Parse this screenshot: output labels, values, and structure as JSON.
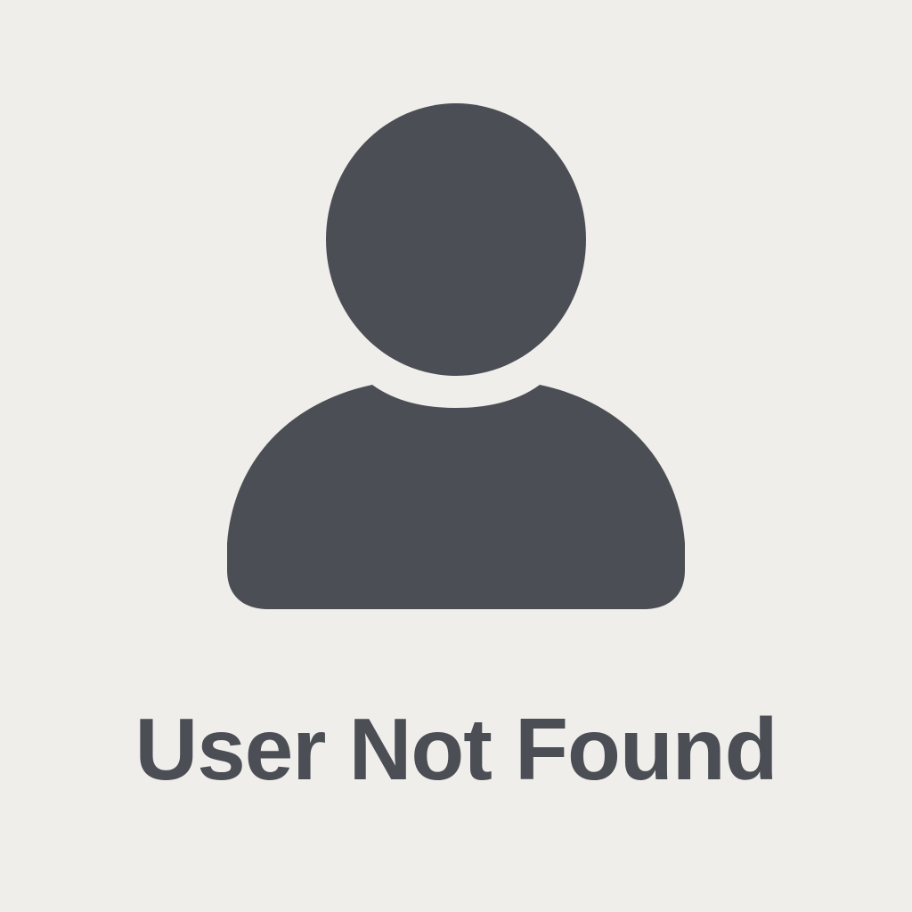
{
  "empty_state": {
    "icon": "user-silhouette-icon",
    "message": "User Not Found"
  },
  "colors": {
    "background": "#f0eeeb",
    "icon": "#4b4e54",
    "text": "#4b4e54"
  }
}
